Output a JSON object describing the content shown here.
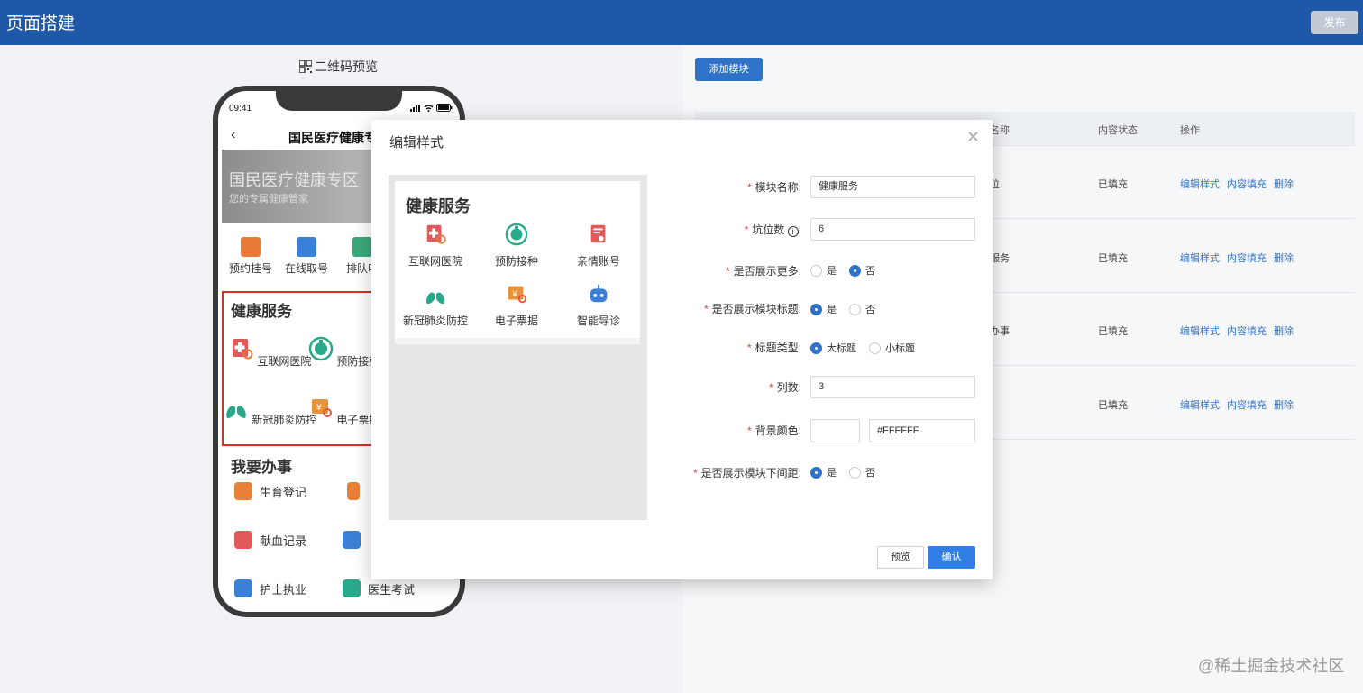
{
  "header": {
    "title": "页面搭建",
    "publish_label": "发布"
  },
  "preview_panel": {
    "qr_label": "二维码预览",
    "phone": {
      "time": "09:41",
      "nav_title": "国民医疗健康专",
      "banner_title": "国民医疗健康专区",
      "banner_subtitle": "您的专属健康管家",
      "quick_items": [
        "预约挂号",
        "在线取号",
        "排队叫"
      ],
      "health_section": {
        "title": "健康服务",
        "items": [
          "互联网医院",
          "预防接种",
          "新冠肺炎防控",
          "电子票据"
        ]
      },
      "todo_section": {
        "title": "我要办事",
        "items": [
          "生育登记",
          "献血记录",
          "护士执业",
          "医生考试"
        ]
      }
    }
  },
  "module_table": {
    "add_button": "添加模块",
    "columns": [
      "名称",
      "内容状态",
      "操作"
    ],
    "rows": [
      {
        "name": "位",
        "status": "已填充"
      },
      {
        "name": "服务",
        "status": "已填充"
      },
      {
        "name": "办事",
        "status": "已填充"
      },
      {
        "name": "",
        "status": "已填充"
      }
    ],
    "actions": {
      "edit_style": "编辑样式",
      "fill_content": "内容填充",
      "delete": "删除"
    }
  },
  "modal": {
    "title": "编辑样式",
    "preview": {
      "title": "健康服务",
      "items": [
        "互联网医院",
        "预防接种",
        "亲情账号",
        "新冠肺炎防控",
        "电子票据",
        "智能导诊"
      ]
    },
    "form": {
      "module_name_label": "模块名称:",
      "module_name_value": "健康服务",
      "slot_count_label": "坑位数",
      "slot_count_colon": ":",
      "slot_count_value": "6",
      "show_more_label": "是否展示更多:",
      "show_title_label": "是否展示模块标题:",
      "title_type_label": "标题类型:",
      "title_big": "大标题",
      "title_small": "小标题",
      "columns_label": "列数:",
      "columns_value": "3",
      "bg_color_label": "背景颜色:",
      "bg_color_value": "#FFFFFF",
      "bottom_gap_label": "是否展示模块下间距:",
      "yes": "是",
      "no": "否"
    },
    "buttons": {
      "preview": "预览",
      "confirm": "确认"
    }
  },
  "watermark": "@稀土掘金技术社区",
  "colors": {
    "header": "#1f58a8",
    "primary": "#2f7fe6",
    "required_star": "#e0463c",
    "highlight_border": "#d93025"
  }
}
